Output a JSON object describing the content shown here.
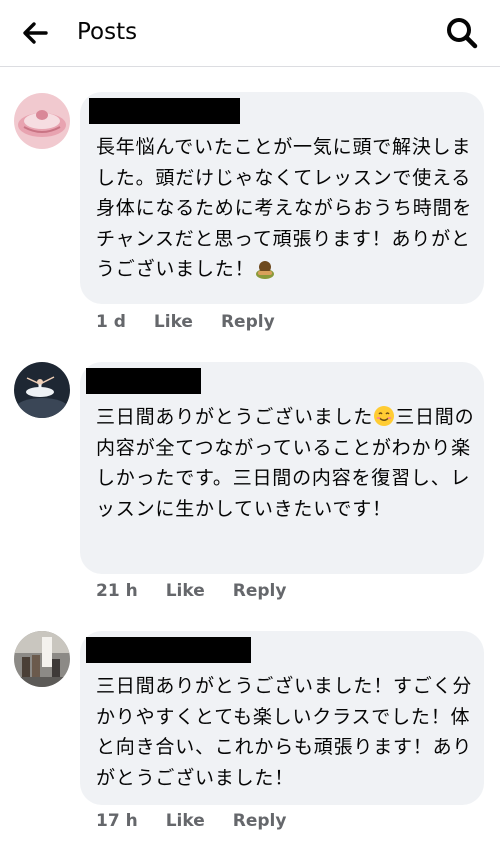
{
  "header": {
    "title": "Posts"
  },
  "comments": [
    {
      "text": "長年悩んでいたことが一気に頭で解決しました。頭だけじゃなくてレッスンで使える身体になるために考えながらおうち時間をチャンスだと思って頑張ります！ありがとうございました！",
      "emoji": "bowing-person-emoji",
      "time": "1 d",
      "like": "Like",
      "reply": "Reply"
    },
    {
      "text_before_emoji": "三日間ありがとうございました",
      "emoji": "smiling-face-emoji",
      "text_after_emoji": "三日間の内容が全てつながっていることがわかり楽しかったです。三日間の内容を復習し、レッスンに生かしていきたいです！",
      "time": "21 h",
      "like": "Like",
      "reply": "Reply"
    },
    {
      "text": "三日間ありがとうございました！すごく分かりやすくとても楽しいクラスでした！体と向き合い、これからも頑張ります！ありがとうございました！",
      "time": "17 h",
      "like": "Like",
      "reply": "Reply"
    }
  ]
}
